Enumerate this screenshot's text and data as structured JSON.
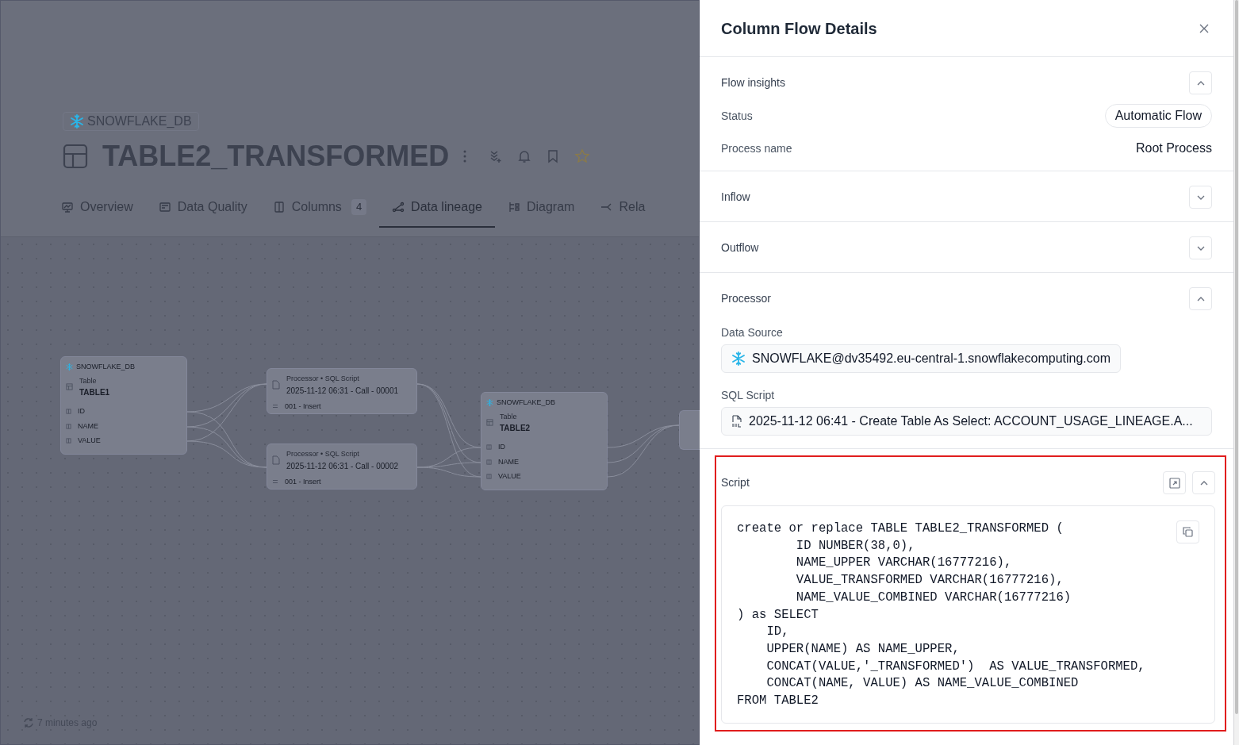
{
  "page": {
    "database": "SNOWFLAKE_DB",
    "title": "TABLE2_TRANSFORMED",
    "tabs": [
      {
        "label": "Overview",
        "selected": false
      },
      {
        "label": "Data Quality",
        "selected": false
      },
      {
        "label": "Columns",
        "badge": "4",
        "selected": false
      },
      {
        "label": "Data lineage",
        "selected": true
      },
      {
        "label": "Diagram",
        "selected": false
      },
      {
        "label": "Rela",
        "selected": false
      }
    ],
    "nodes": [
      {
        "kind": "table",
        "database": "SNOWFLAKE_DB",
        "type": "Table",
        "name": "TABLE1",
        "columns": [
          "ID",
          "NAME",
          "VALUE"
        ]
      },
      {
        "kind": "process",
        "type": "Processor • SQL Script",
        "name": "2025-11-12 06:31 - Call - 00001",
        "operation": "001 - Insert"
      },
      {
        "kind": "process",
        "type": "Processor • SQL Script",
        "name": "2025-11-12 06:31 - Call - 00002",
        "operation": "001 - Insert"
      },
      {
        "kind": "table",
        "database": "SNOWFLAKE_DB",
        "type": "Table",
        "name": "TABLE2",
        "columns": [
          "ID",
          "NAME",
          "VALUE"
        ]
      },
      {
        "kind": "partial"
      }
    ],
    "updated": "7 minutes ago"
  },
  "panel": {
    "title": "Column Flow Details",
    "sections": [
      {
        "kind": "insights",
        "title": "Flow insights",
        "expanded": true,
        "rows": [
          {
            "label": "Status",
            "value": "Automatic Flow",
            "kind": "pill"
          },
          {
            "label": "Process name",
            "value": "Root Process",
            "kind": "text"
          }
        ]
      },
      {
        "kind": "list",
        "title": "Inflow",
        "expanded": false
      },
      {
        "kind": "list",
        "title": "Outflow",
        "expanded": false
      },
      {
        "kind": "processor",
        "title": "Processor",
        "expanded": true,
        "fields": [
          {
            "label": "Data Source",
            "kind": "datasource",
            "value": "SNOWFLAKE@dv35492.eu-central-1.snowflakecomputing.com"
          },
          {
            "label": "SQL Script",
            "kind": "script",
            "value": "2025-11-12 06:41 - Create Table As Select: ACCOUNT_USAGE_LINEAGE.A..."
          }
        ]
      },
      {
        "kind": "script",
        "title": "Script",
        "expanded": true,
        "highlighted": true,
        "code": "create or replace TABLE TABLE2_TRANSFORMED (\n        ID NUMBER(38,0),\n        NAME_UPPER VARCHAR(16777216),\n        VALUE_TRANSFORMED VARCHAR(16777216),\n        NAME_VALUE_COMBINED VARCHAR(16777216)\n) as SELECT\n    ID,\n    UPPER(NAME) AS NAME_UPPER,\n    CONCAT(VALUE,'_TRANSFORMED')  AS VALUE_TRANSFORMED,\n    CONCAT(NAME, VALUE) AS NAME_VALUE_COMBINED\nFROM TABLE2"
      }
    ]
  }
}
